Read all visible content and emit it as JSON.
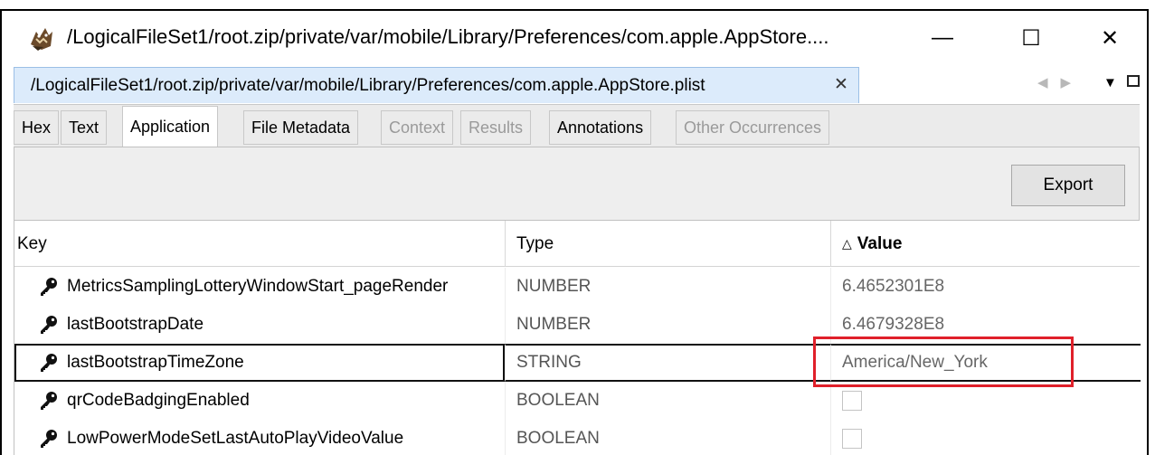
{
  "window": {
    "title": "/LogicalFileSet1/root.zip/private/var/mobile/Library/Preferences/com.apple.AppStore....",
    "minimize_label": "—",
    "maximize_label": "☐",
    "close_label": "✕"
  },
  "document_tab": {
    "label": "/LogicalFileSet1/root.zip/private/var/mobile/Library/Preferences/com.apple.AppStore.plist",
    "close_label": "✕"
  },
  "viewer_tabs": [
    {
      "label": "Hex",
      "state": "enabled"
    },
    {
      "label": "Text",
      "state": "enabled"
    },
    {
      "label": "Application",
      "state": "active"
    },
    {
      "label": "File Metadata",
      "state": "enabled"
    },
    {
      "label": "Context",
      "state": "disabled"
    },
    {
      "label": "Results",
      "state": "disabled"
    },
    {
      "label": "Annotations",
      "state": "enabled"
    },
    {
      "label": "Other Occurrences",
      "state": "disabled"
    }
  ],
  "toolbar": {
    "export_label": "Export"
  },
  "table": {
    "columns": {
      "key": "Key",
      "type": "Type",
      "value": "Value"
    },
    "sort_indicator": "△",
    "rows": [
      {
        "key": "MetricsSamplingLotteryWindowStart_pageRender",
        "type": "NUMBER",
        "value": "6.4652301E8"
      },
      {
        "key": "lastBootstrapDate",
        "type": "NUMBER",
        "value": "6.4679328E8"
      },
      {
        "key": "lastBootstrapTimeZone",
        "type": "STRING",
        "value": "America/New_York"
      },
      {
        "key": "qrCodeBadgingEnabled",
        "type": "BOOLEAN",
        "value": ""
      },
      {
        "key": "LowPowerModeSetLastAutoPlayVideoValue",
        "type": "BOOLEAN",
        "value": ""
      }
    ],
    "selected_row_key": "lastBootstrapTimeZone"
  },
  "colors": {
    "doc_tab_bg": "#dcebfb",
    "highlight_border": "#e0202a",
    "disabled_text": "#9a9a9a"
  },
  "icons": {
    "app": "autopsy-dog-icon",
    "row": "key-icon"
  }
}
